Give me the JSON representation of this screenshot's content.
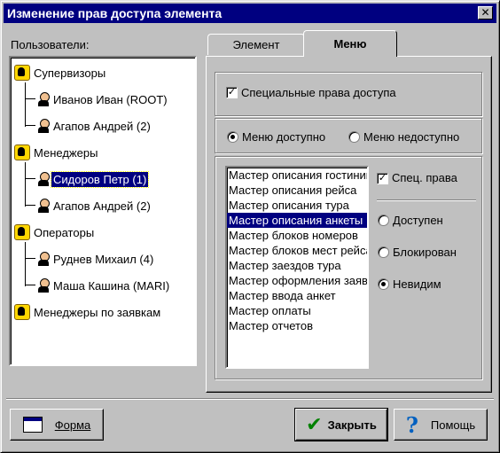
{
  "window": {
    "title": "Изменение прав доступа элемента",
    "close_glyph": "✕"
  },
  "users": {
    "label": "Пользователи:",
    "tree": [
      {
        "type": "group",
        "label": "Супервизоры"
      },
      {
        "type": "user",
        "label": "Иванов Иван (ROOT)"
      },
      {
        "type": "user",
        "label": "Агапов Андрей (2)"
      },
      {
        "type": "group",
        "label": "Менеджеры"
      },
      {
        "type": "user",
        "label": "Сидоров Петр (1)",
        "selected": true
      },
      {
        "type": "user",
        "label": "Агапов Андрей (2)"
      },
      {
        "type": "group",
        "label": "Операторы"
      },
      {
        "type": "user",
        "label": "Руднев Михаил (4)"
      },
      {
        "type": "user",
        "label": "Маша Кашина (MARI)"
      },
      {
        "type": "group",
        "label": "Менеджеры по заявкам"
      }
    ]
  },
  "tabs": [
    {
      "label": "Элемент",
      "active": false
    },
    {
      "label": "Меню",
      "active": true
    }
  ],
  "menu_tab": {
    "special_rights": {
      "label": "Специальные права доступа",
      "checked": true
    },
    "menu_available": {
      "label": "Меню доступно",
      "checked": true
    },
    "menu_unavailable": {
      "label": "Меню недоступно",
      "checked": false
    },
    "items": [
      "Мастер описания гостиниц",
      "Мастер описания рейса",
      "Мастер описания тура",
      "Мастер описания анкеты",
      "Мастер блоков номеров",
      "Мастер блоков мест рейса",
      "Мастер заездов тура",
      "Мастер оформления заявки",
      "Мастер ввода анкет",
      "Мастер оплаты",
      "Мастер отчетов"
    ],
    "selected_item_index": 3,
    "spec_rights": {
      "label": "Спец. права",
      "checked": true
    },
    "access": {
      "available": "Доступен",
      "blocked": "Блокирован",
      "invisible": "Невидим",
      "selected": "invisible"
    }
  },
  "buttons": {
    "form": "Форма",
    "close": "Закрыть",
    "help": "Помощь"
  },
  "colors": {
    "selection": "#000080",
    "face": "#c0c0c0",
    "title": "#000080"
  }
}
